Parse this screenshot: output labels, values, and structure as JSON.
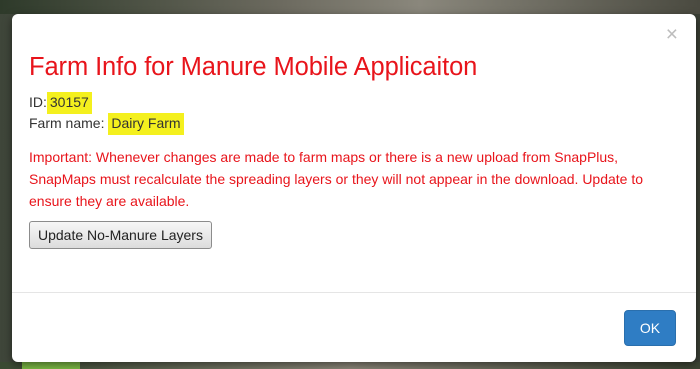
{
  "modal": {
    "close_glyph": "×",
    "title": "Farm Info for Manure Mobile Applicaiton",
    "id_label": "ID:",
    "id_value": "30157",
    "farm_name_label": "Farm name:",
    "farm_name_value": "Dairy Farm",
    "important_text": "Important: Whenever changes are made to farm maps or there is a new upload from SnapPlus, SnapMaps must recalculate the spreading layers or they will not appear in the download. Update to ensure they are available.",
    "update_button_label": "Update No-Manure Layers",
    "ok_button_label": "OK"
  },
  "colors": {
    "title_red": "#e8141b",
    "highlight_yellow": "#f4f01e",
    "ok_blue": "#2f7dc4"
  }
}
